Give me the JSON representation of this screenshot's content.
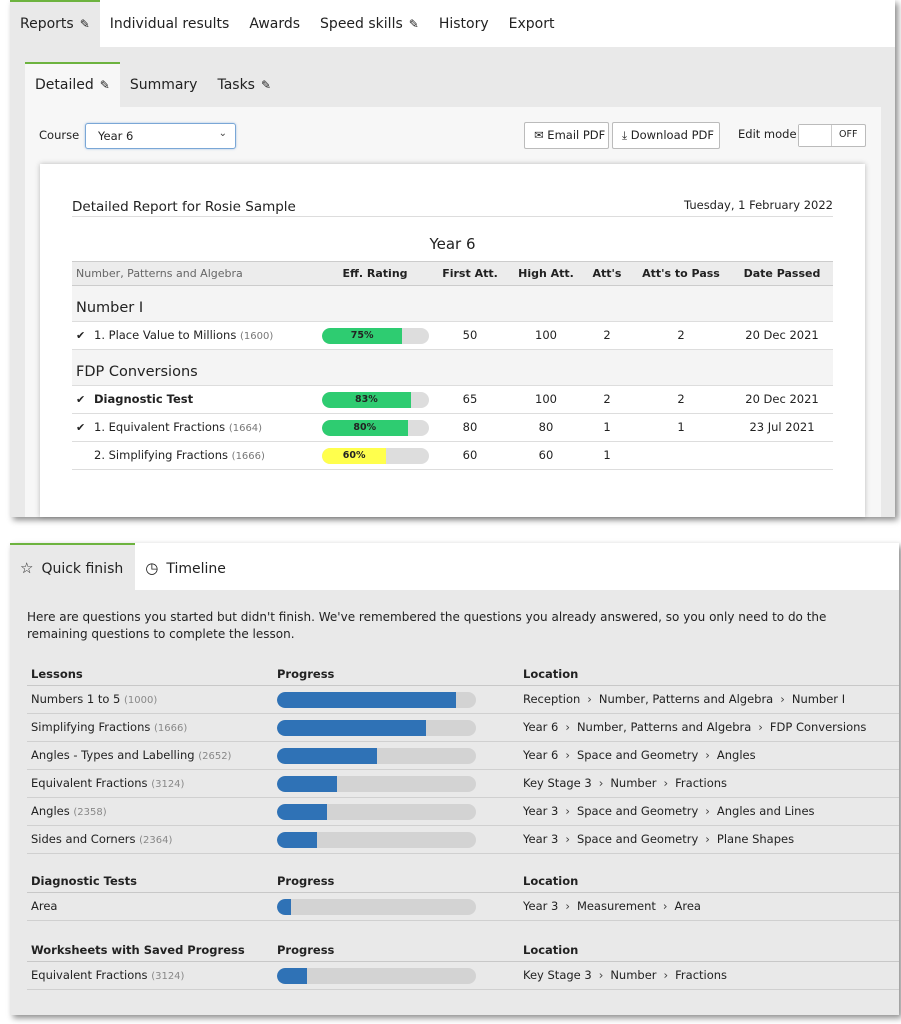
{
  "top_tabs": [
    {
      "label": "Reports",
      "active": true,
      "editable": true
    },
    {
      "label": "Individual results",
      "active": false,
      "editable": false
    },
    {
      "label": "Awards",
      "active": false,
      "editable": false
    },
    {
      "label": "Speed skills",
      "active": false,
      "editable": true
    },
    {
      "label": "History",
      "active": false,
      "editable": false
    },
    {
      "label": "Export",
      "active": false,
      "editable": false
    }
  ],
  "sub_tabs": [
    {
      "label": "Detailed",
      "active": true,
      "editable": true
    },
    {
      "label": "Summary",
      "active": false,
      "editable": false
    },
    {
      "label": "Tasks",
      "active": false,
      "editable": true
    }
  ],
  "controls": {
    "course_label": "Course",
    "course_value": "Year 6",
    "email_pdf": "Email PDF",
    "download_pdf": "Download PDF",
    "edit_mode_label": "Edit mode",
    "edit_mode_state": "OFF"
  },
  "report": {
    "title": "Detailed Report for Rosie Sample",
    "date": "Tuesday, 1 February 2022",
    "course": "Year 6",
    "headers": {
      "name": "Number, Patterns and Algebra",
      "eff": "Eff. Rating",
      "first": "First Att.",
      "high": "High Att.",
      "atts": "Att's",
      "pass": "Att's to Pass",
      "date": "Date Passed"
    },
    "groups": [
      {
        "name": "Number I",
        "rows": [
          {
            "check": true,
            "bold": false,
            "name": "1. Place Value to Millions",
            "code": "(1600)",
            "eff": 75,
            "eff_label": "75%",
            "eff_color": "#2ecc71",
            "first": "50",
            "high": "100",
            "atts": "2",
            "pass": "2",
            "date": "20 Dec 2021"
          }
        ]
      },
      {
        "name": "FDP Conversions",
        "rows": [
          {
            "check": true,
            "bold": true,
            "name": "Diagnostic Test",
            "code": "",
            "eff": 83,
            "eff_label": "83%",
            "eff_color": "#2ecc71",
            "first": "65",
            "high": "100",
            "atts": "2",
            "pass": "2",
            "date": "20 Dec 2021"
          },
          {
            "check": true,
            "bold": false,
            "name": "1. Equivalent Fractions",
            "code": "(1664)",
            "eff": 80,
            "eff_label": "80%",
            "eff_color": "#2ecc71",
            "first": "80",
            "high": "80",
            "atts": "1",
            "pass": "1",
            "date": "23 Jul 2021"
          },
          {
            "check": false,
            "bold": false,
            "name": "2. Simplifying Fractions",
            "code": "(1666)",
            "eff": 60,
            "eff_label": "60%",
            "eff_color": "#ffff4d",
            "first": "60",
            "high": "60",
            "atts": "1",
            "pass": "",
            "date": ""
          }
        ]
      }
    ]
  },
  "quick_tabs": [
    {
      "label": "Quick finish",
      "icon": "star-icon",
      "active": true
    },
    {
      "label": "Timeline",
      "icon": "clock-icon",
      "active": false
    }
  ],
  "quick": {
    "intro": "Here are questions you started but didn't finish. We've remembered the questions you already answered, so you only need to do the remaining questions to complete the lesson.",
    "sections": [
      {
        "heading": "Lessons",
        "progress_heading": "Progress",
        "location_heading": "Location",
        "items": [
          {
            "name": "Numbers 1 to 5",
            "code": "(1000)",
            "progress": 0.9,
            "location": [
              "Reception",
              "Number, Patterns and Algebra",
              "Number I"
            ]
          },
          {
            "name": "Simplifying Fractions",
            "code": "(1666)",
            "progress": 0.75,
            "location": [
              "Year 6",
              "Number, Patterns and Algebra",
              "FDP Conversions"
            ]
          },
          {
            "name": "Angles - Types and Labelling",
            "code": "(2652)",
            "progress": 0.5,
            "location": [
              "Year 6",
              "Space and Geometry",
              "Angles"
            ]
          },
          {
            "name": "Equivalent Fractions",
            "code": "(3124)",
            "progress": 0.3,
            "location": [
              "Key Stage 3",
              "Number",
              "Fractions"
            ]
          },
          {
            "name": "Angles",
            "code": "(2358)",
            "progress": 0.25,
            "location": [
              "Year 3",
              "Space and Geometry",
              "Angles and Lines"
            ]
          },
          {
            "name": "Sides and Corners",
            "code": "(2364)",
            "progress": 0.2,
            "location": [
              "Year 3",
              "Space and Geometry",
              "Plane Shapes"
            ]
          }
        ]
      },
      {
        "heading": "Diagnostic Tests",
        "progress_heading": "Progress",
        "location_heading": "Location",
        "items": [
          {
            "name": "Area",
            "code": "",
            "progress": 0.07,
            "location": [
              "Year 3",
              "Measurement",
              "Area"
            ]
          }
        ]
      },
      {
        "heading": "Worksheets with Saved Progress",
        "progress_heading": "Progress",
        "location_heading": "Location",
        "items": [
          {
            "name": "Equivalent Fractions",
            "code": "(3124)",
            "progress": 0.15,
            "location": [
              "Key Stage 3",
              "Number",
              "Fractions"
            ]
          }
        ]
      }
    ]
  }
}
